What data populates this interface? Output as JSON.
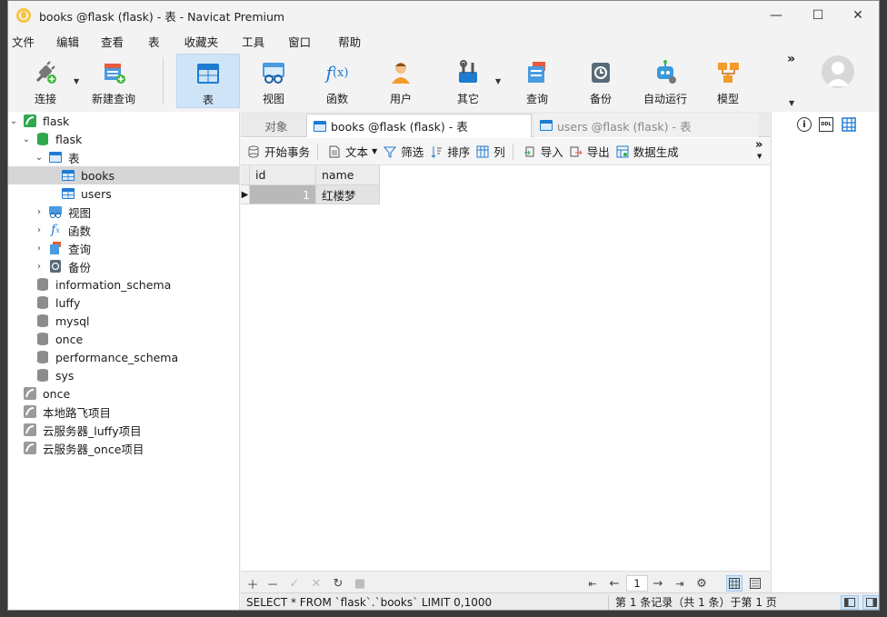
{
  "window": {
    "title": "books @flask (flask) - 表 - Navicat Premium"
  },
  "menu": [
    "文件",
    "编辑",
    "查看",
    "表",
    "收藏夹",
    "工具",
    "窗口",
    "帮助"
  ],
  "toolbar": {
    "connect": "连接",
    "new_query": "新建查询",
    "table": "表",
    "view": "视图",
    "function": "函数",
    "user": "用户",
    "other": "其它",
    "query": "查询",
    "backup": "备份",
    "automation": "自动运行",
    "model": "模型",
    "more": "»"
  },
  "tree": {
    "conn_flask": "flask",
    "db_flask": "flask",
    "tables": "表",
    "table_books": "books",
    "table_users": "users",
    "views": "视图",
    "functions": "函数",
    "queries": "查询",
    "backups": "备份",
    "db_information_schema": "information_schema",
    "db_luffy": "luffy",
    "db_mysql": "mysql",
    "db_once": "once",
    "db_performance_schema": "performance_schema",
    "db_sys": "sys",
    "conn_once": "once",
    "conn_local": "本地路飞项目",
    "conn_cloud_luffy": "云服务器_luffy项目",
    "conn_cloud_once": "云服务器_once项目"
  },
  "tabs": {
    "objects": "对象",
    "books": "books @flask (flask) - 表",
    "users": "users @flask (flask) - 表"
  },
  "subtoolbar": {
    "begin_tx": "开始事务",
    "text": "文本",
    "filter": "筛选",
    "sort": "排序",
    "columns": "列",
    "import": "导入",
    "export": "导出",
    "generate": "数据生成",
    "more": "»"
  },
  "grid": {
    "columns": [
      "id",
      "name"
    ],
    "rows": [
      [
        "1",
        "红楼梦"
      ]
    ]
  },
  "pager": {
    "page": "1"
  },
  "status": {
    "sql": "SELECT * FROM `flask`.`books` LIMIT 0,1000",
    "records": "第 1 条记录（共 1 条）于第 1 页"
  },
  "colors": {
    "accent": "#1e7bd2",
    "selected_row": "#cfcfcf",
    "active_tool": "#cfe5f7"
  }
}
